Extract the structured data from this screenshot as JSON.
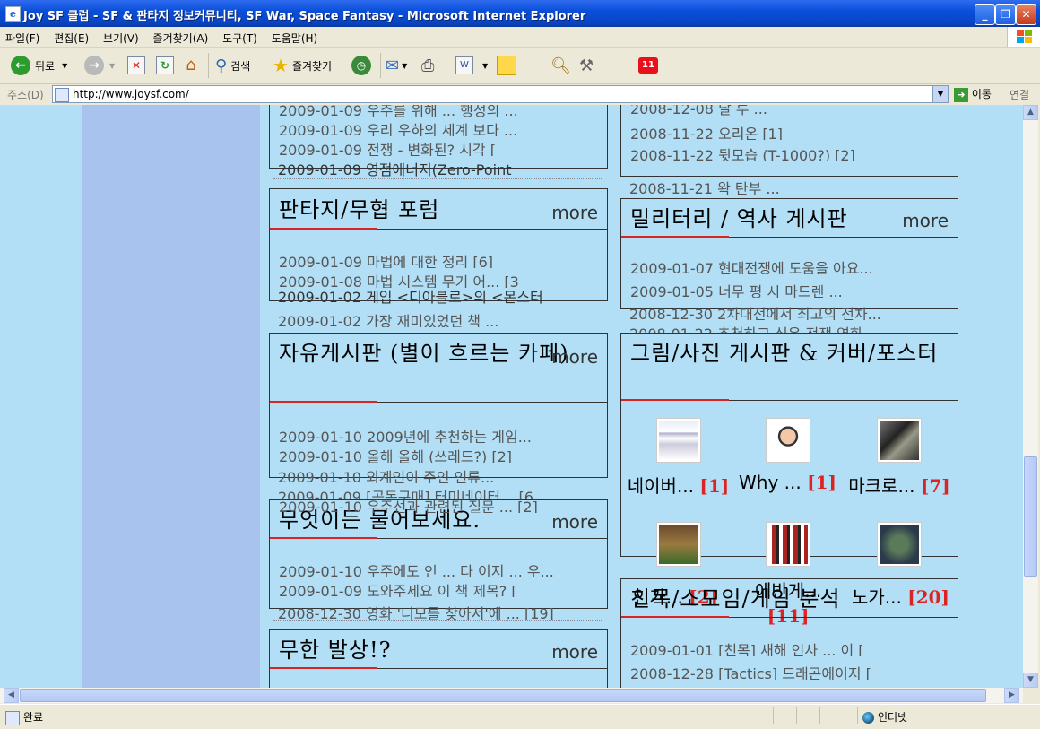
{
  "window": {
    "title": "Joy SF 클럽 - SF & 판타지 정보커뮤니티, SF War, Space Fantasy - Microsoft Internet Explorer",
    "app_icon": "e"
  },
  "menu": [
    "파일(F)",
    "편집(E)",
    "보기(V)",
    "즐겨찾기(A)",
    "도구(T)",
    "도움말(H)"
  ],
  "toolbar": {
    "back": "뒤로",
    "search": "검색",
    "favorites": "즐겨찾기"
  },
  "address": {
    "label": "주소(D)",
    "url": "http://www.joysf.com/",
    "go": "이동",
    "links": "연결"
  },
  "boards": {
    "top_left_rows": [
      "2009-01-09 우주를 위해 ... 행성의 ...",
      "2009-01-09 우리 우하의 세계 보다 ...",
      "2009-01-09 전쟁 - 변화된? 시각 [",
      "2009-01-09 영점에너지(Zero-Point"
    ],
    "fantasy": {
      "title": "판타지/무협 포럼",
      "more": "more",
      "rows": [
        "2009-01-09 마법에 대한 정리 [6]",
        "2009-01-08 마법 시스템 무기 어... [3",
        "2009-01-02 게임 <디아블로>의 <몬스터",
        "2009-01-02 가장 재미있었던 책 ..."
      ]
    },
    "free": {
      "title": "자유게시판 (별이 흐르는 카페)",
      "more": "more",
      "rows": [
        "2009-01-10 2009년에 추천하는 게임...",
        "2009-01-10 올해 올해 (쓰레드?) [2]",
        "2009-01-10 외계인이 주인 인류...",
        "2009-01-09 [공동구매] 터미네이터... [6"
      ]
    },
    "ask": {
      "title": "무엇이든 물어보세요.",
      "more": "more",
      "rows": [
        "2009-01-10 우주선과 관련된 질문 ... [2]",
        "2009-01-10 우주에도 인 ... 다 이지 ... 우...",
        "2009-01-09 도와주세요 이 책 제목? [",
        "2008-12-30 영화 '니모를 찾아서'에 ... [19]"
      ]
    },
    "infinite": {
      "title": "무한 발상!?",
      "more": "more"
    },
    "top_right_rows": [
      "2008-12-08 달 루 ...",
      "2008-11-22 오리온 [1]",
      "2008-11-22 뒷모습 (T-1000?) [2]",
      "2008-11-21 왁 탄부 ..."
    ],
    "military": {
      "title": "밀리터리 / 역사 게시판",
      "more": "more",
      "rows": [
        "2009-01-07 현대전쟁에 도움을 아요...",
        "2009-01-05 너무 평 시 마드렌 ...",
        "2008-12-30 2차대전에서 최고의 전차...",
        "2008-01-22 추천하고 싶은 전쟁 영화"
      ]
    },
    "gallery": {
      "title": "그림/사진 게시판 & 커버/포스터",
      "items": [
        {
          "caption": "네이버...",
          "count": "[1]"
        },
        {
          "caption": "Why ...",
          "count": "[1]"
        },
        {
          "caption": "마크로...",
          "count": "[7]"
        },
        {
          "caption": "인가...",
          "count": "[2]"
        },
        {
          "caption": "에반게...",
          "count": "[11]"
        },
        {
          "caption": "노가...",
          "count": "[20]"
        }
      ]
    },
    "club": {
      "title": "친목/소모임/게임 분석",
      "rows": [
        "2009-01-01 [친목] 새해 인사 ... 이 [",
        "2008-12-28 [Tactics] 드래곤에이지 ["
      ]
    }
  },
  "status": {
    "text": "완료",
    "zone": "인터넷"
  },
  "colors": {
    "page_bg": "#b2dff5",
    "left_column": "#a8c4ee",
    "accent_underline": "#dd2222",
    "count_orange": "#f07010",
    "titlebar": "#0a4fd9"
  }
}
